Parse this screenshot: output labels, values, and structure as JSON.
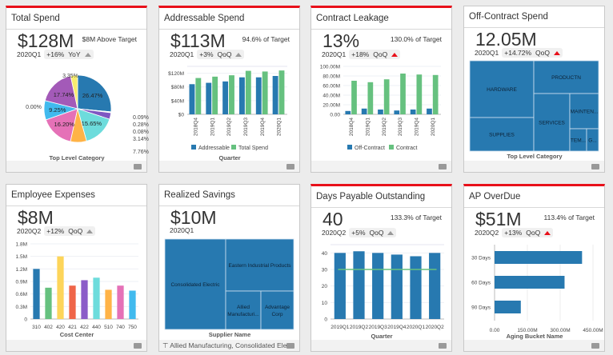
{
  "colors": {
    "blue": "#2779b0",
    "green": "#66c17f",
    "red": "#e8101a"
  },
  "cards": [
    {
      "title": "Total Spend",
      "value": "$128M",
      "period": "2020Q1",
      "delta": "+16%",
      "comp": "YoY",
      "trend": "up-gray",
      "target": "$8M Above Target",
      "chart_data": {
        "type": "pie",
        "xlabel": "Top Level Category",
        "slices": [
          {
            "value": 26.47,
            "label": "26.47%",
            "color": "#2779b0"
          },
          {
            "value": 0.09,
            "label": "0.09%",
            "color": "#c5b0d5"
          },
          {
            "value": 0.28,
            "label": "0.28%",
            "color": "#9467bd"
          },
          {
            "value": 0.08,
            "label": "0.08%",
            "color": "#bcbd22"
          },
          {
            "value": 3.14,
            "label": "3.14%",
            "color": "#7e57c2"
          },
          {
            "value": 15.65,
            "label": "15.65%",
            "color": "#6ddcdc"
          },
          {
            "value": 7.76,
            "label": "7.76%",
            "color": "#ffb347"
          },
          {
            "value": 16.2,
            "label": "16.20%",
            "color": "#e571b7"
          },
          {
            "value": 9.25,
            "label": "9.25%",
            "color": "#41baee"
          },
          {
            "value": 0.0,
            "label": "0.00%",
            "color": "#888888"
          },
          {
            "value": 17.74,
            "label": "17.74%",
            "color": "#a35ab8"
          },
          {
            "value": 3.35,
            "label": "3.35%",
            "color": "#f7ec6e"
          }
        ]
      }
    },
    {
      "title": "Addressable Spend",
      "value": "$113M",
      "period": "2020Q1",
      "delta": "+3%",
      "comp": "QoQ",
      "trend": "up-gray",
      "target": "94.6% of Target",
      "chart_data": {
        "type": "bar",
        "xlabel": "Quarter",
        "categories": [
          "2018Q4",
          "2019Q1",
          "2019Q2",
          "2019Q3",
          "2019Q4",
          "2020Q1"
        ],
        "ylim": [
          0,
          140
        ],
        "yticks": [
          {
            "v": 0,
            "label": "$0"
          },
          {
            "v": 40,
            "label": "$40M"
          },
          {
            "v": 80,
            "label": "$80M"
          },
          {
            "v": 120,
            "label": "$120M"
          }
        ],
        "series": [
          {
            "name": "Addressable",
            "values": [
              88,
              92,
              96,
              108,
              108,
              112
            ],
            "color": "#2779b0"
          },
          {
            "name": "Total Spend",
            "values": [
              106,
              110,
              114,
              127,
              125,
              128
            ],
            "color": "#66c17f"
          }
        ]
      }
    },
    {
      "title": "Contract Leakage",
      "value": "13%",
      "period": "2020Q1",
      "delta": "+18%",
      "comp": "QoQ",
      "trend": "up-red",
      "target": "130.0% of Target",
      "chart_data": {
        "type": "bar",
        "categories": [
          "2018Q4",
          "2019Q1",
          "2019Q2",
          "2019Q3",
          "2019Q4",
          "2020Q1"
        ],
        "ylim": [
          0,
          100
        ],
        "yticks": [
          {
            "v": 0,
            "label": "0.00"
          },
          {
            "v": 20,
            "label": "20.00M"
          },
          {
            "v": 40,
            "label": "40.00M"
          },
          {
            "v": 60,
            "label": "60.00M"
          },
          {
            "v": 80,
            "label": "80.00M"
          },
          {
            "v": 100,
            "label": "100.00M"
          }
        ],
        "series": [
          {
            "name": "Off-Contract",
            "values": [
              7,
              12,
              10,
              8,
              10,
              12
            ],
            "color": "#2779b0"
          },
          {
            "name": "Contract",
            "values": [
              70,
              67,
              73,
              85,
              83,
              82
            ],
            "color": "#66c17f"
          }
        ]
      }
    },
    {
      "title": "Off-Contract Spend",
      "value": "12.05M",
      "period": "2020Q1",
      "delta": "+14.72%",
      "comp": "QoQ",
      "trend": "up-red",
      "chart_data": {
        "type": "treemap",
        "xlabel": "Top Level Category",
        "items": [
          "HARDWARE",
          "SUPPLIES",
          "PRODUCTN",
          "SERVICES",
          "MAINTEN...",
          "TEM...",
          "G..."
        ]
      }
    },
    {
      "title": "Employee Expenses",
      "value": "$8M",
      "period": "2020Q2",
      "delta": "+12%",
      "comp": "QoQ",
      "trend": "up-gray",
      "chart_data": {
        "type": "bar",
        "xlabel": "Cost Center",
        "categories": [
          "310",
          "402",
          "420",
          "421",
          "422",
          "440",
          "510",
          "740",
          "750"
        ],
        "ylim": [
          0,
          1.8
        ],
        "yticks": [
          {
            "v": 0,
            "label": "0"
          },
          {
            "v": 0.3,
            "label": "0.3M"
          },
          {
            "v": 0.6,
            "label": "0.6M"
          },
          {
            "v": 0.9,
            "label": "0.9M"
          },
          {
            "v": 1.2,
            "label": "1.2M"
          },
          {
            "v": 1.5,
            "label": "1.5M"
          },
          {
            "v": 1.8,
            "label": "1.8M"
          }
        ],
        "values": [
          1.2,
          0.75,
          1.5,
          0.8,
          0.93,
          0.99,
          0.7,
          0.8,
          0.68
        ],
        "colors": [
          "#2779b0",
          "#66c17f",
          "#fdd55a",
          "#ef6548",
          "#8b5cc8",
          "#6ddcdc",
          "#ffb347",
          "#e571b7",
          "#41baee"
        ]
      }
    },
    {
      "title": "Realized Savings",
      "value": "$10M",
      "period": "2020Q1",
      "filter": "Allied Manufacturing, Consolidated Ele...",
      "chart_data": {
        "type": "treemap",
        "xlabel": "Supplier Name",
        "items": [
          "Consolidated Electric",
          "Eastern Industrial Products",
          "Allied Manufacturi...",
          "Advantage Corp"
        ]
      }
    },
    {
      "title": "Days Payable Outstanding",
      "value": "40",
      "period": "2020Q2",
      "delta": "+5%",
      "comp": "QoQ",
      "trend": "up-gray",
      "target": "133.3% of Target",
      "chart_data": {
        "type": "bar",
        "xlabel": "Quarter",
        "categories": [
          "2019Q1",
          "2019Q2",
          "2019Q3",
          "2019Q4",
          "2020Q1",
          "2020Q2"
        ],
        "ylim": [
          0,
          45
        ],
        "yticks": [
          {
            "v": 0,
            "label": "0"
          },
          {
            "v": 10,
            "label": "10"
          },
          {
            "v": 20,
            "label": "20"
          },
          {
            "v": 30,
            "label": "30"
          },
          {
            "v": 40,
            "label": "40"
          }
        ],
        "values": [
          40,
          41,
          40,
          39,
          38,
          40
        ],
        "target_line": 30
      }
    },
    {
      "title": "AP OverDue",
      "value": "$51M",
      "period": "2020Q2",
      "delta": "+13%",
      "comp": "QoQ",
      "trend": "up-red",
      "target": "113.4% of Target",
      "chart_data": {
        "type": "hbar",
        "xlabel": "Aging Bucket Name",
        "categories": [
          "30 Days",
          "60 Days",
          "90 Days"
        ],
        "values": [
          400,
          320,
          120
        ],
        "xlim": [
          0,
          450
        ],
        "xticks": [
          {
            "v": 0,
            "label": "0.00"
          },
          {
            "v": 150,
            "label": "150.00M"
          },
          {
            "v": 300,
            "label": "300.00M"
          },
          {
            "v": 450,
            "label": "450.00M"
          }
        ]
      }
    }
  ]
}
